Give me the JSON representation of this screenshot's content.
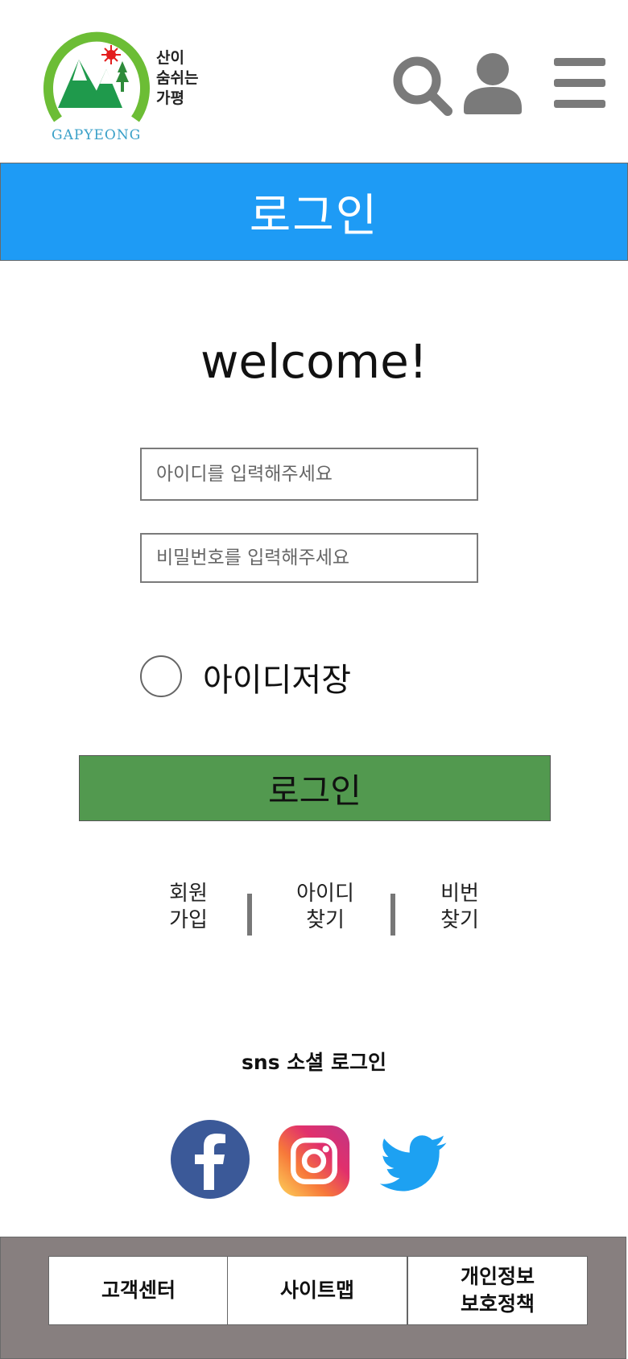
{
  "header": {
    "logo_caption": "산이\n숨쉬는\n가평",
    "logo_wordmark": "GAPYEONG",
    "icons": [
      "search-icon",
      "user-icon",
      "menu-icon"
    ]
  },
  "banner": {
    "title": "로그인"
  },
  "form": {
    "welcome": "welcome!",
    "id_placeholder": "아이디를 입력해주세요",
    "pw_placeholder": "비밀번호를 입력해주세요",
    "remember_label": "아이디저장",
    "login_button": "로그인"
  },
  "links": {
    "signup": "회원\n가입",
    "find_id": "아이디\n찾기",
    "find_pw": "비번\n찾기"
  },
  "sns": {
    "title": "sns 소셜 로그인",
    "providers": [
      "facebook-icon",
      "instagram-icon",
      "twitter-icon"
    ]
  },
  "footer": {
    "customer_center": "고객센터",
    "sitemap": "사이트맵",
    "privacy": "개인정보\n보호정책"
  },
  "colors": {
    "banner": "#1e9bf5",
    "login_button": "#52994f",
    "footer": "#877f7f",
    "icon_gray": "#7a7a7a"
  }
}
